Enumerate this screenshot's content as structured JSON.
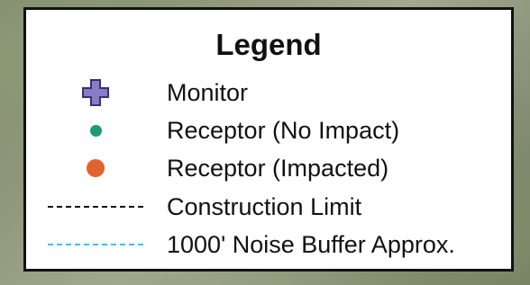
{
  "legend": {
    "title": "Legend",
    "items": [
      {
        "label": "Monitor",
        "symbol": "plus",
        "color": "#8a7cc4",
        "outline": "#3b2d7a"
      },
      {
        "label": "Receptor (No Impact)",
        "symbol": "dot",
        "color": "#1d9a7a"
      },
      {
        "label": "Receptor (Impacted)",
        "symbol": "dot",
        "color": "#e0632e"
      },
      {
        "label": "Construction Limit",
        "symbol": "dashed-line",
        "color": "#111111"
      },
      {
        "label": "1000' Noise Buffer Approx.",
        "symbol": "dashed-line",
        "color": "#33c6e6"
      }
    ]
  }
}
